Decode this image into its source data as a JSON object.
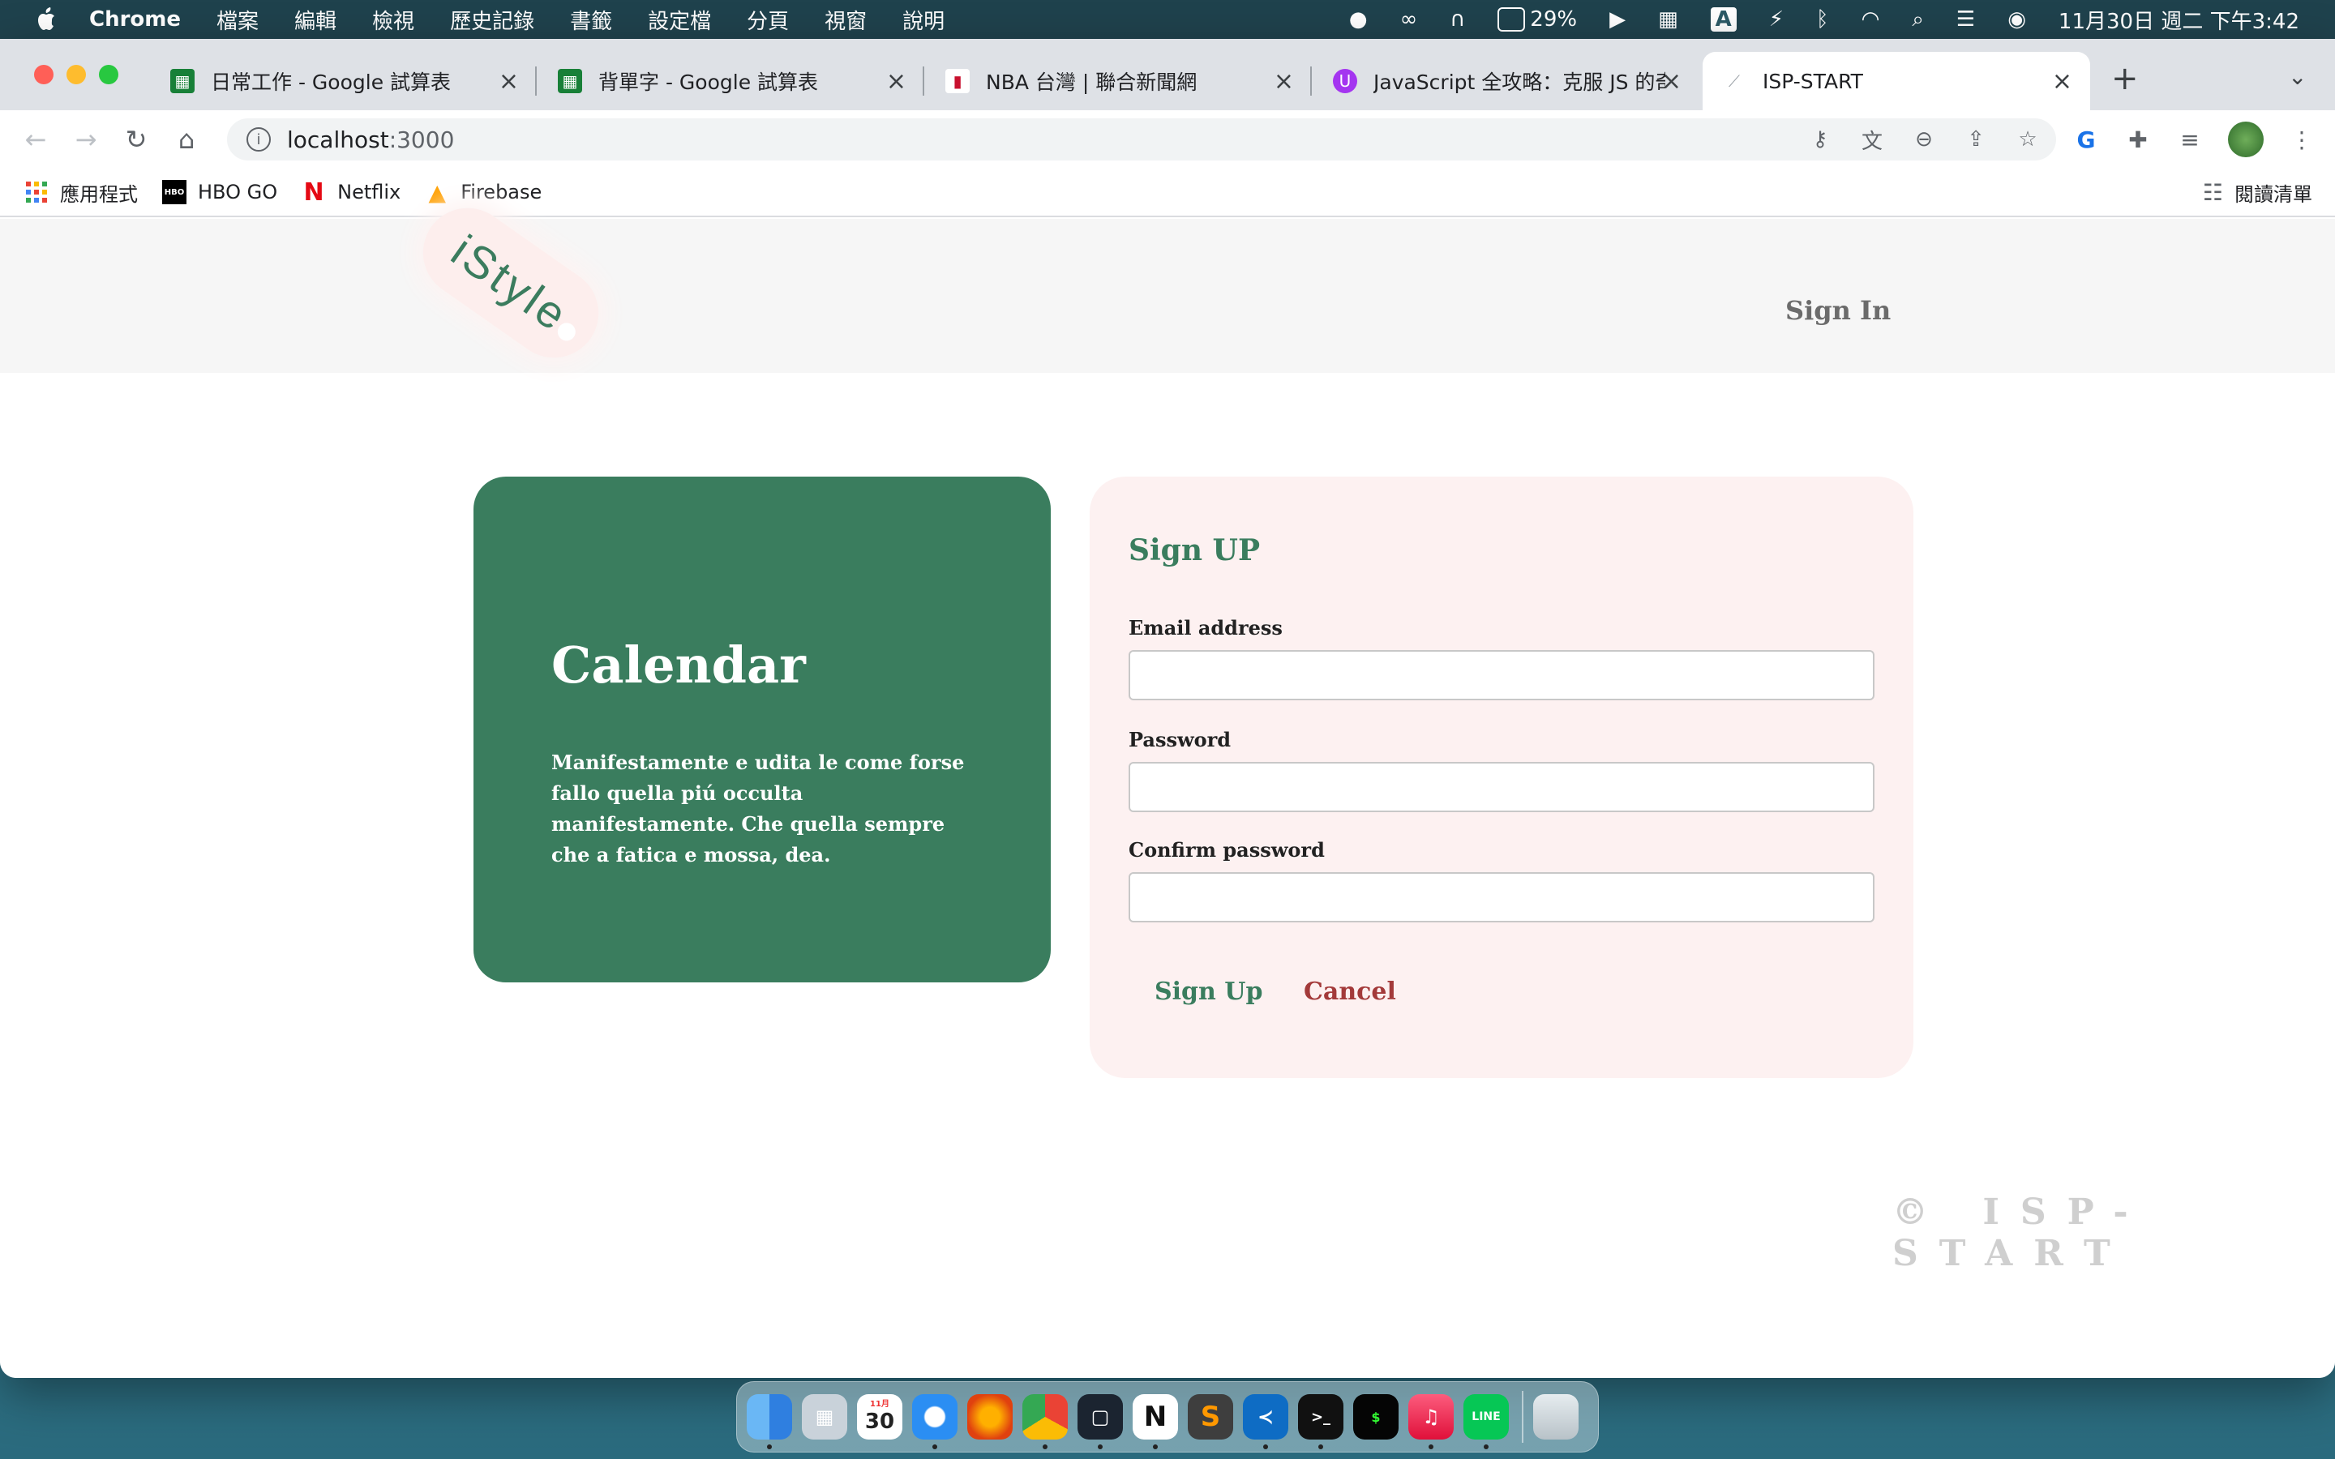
{
  "menubar": {
    "app": "Chrome",
    "menus": [
      "檔案",
      "編輯",
      "檢視",
      "歷史記錄",
      "書籤",
      "設定檔",
      "分頁",
      "視窗",
      "說明"
    ],
    "battery": "29%",
    "input_method": "A",
    "clock": "11月30日 週二 下午3:42"
  },
  "tabs": [
    {
      "title": "日常工作 - Google 試算表",
      "icon": "google-sheets-icon"
    },
    {
      "title": "背單字 - Google 試算表",
      "icon": "google-sheets-icon"
    },
    {
      "title": "NBA 台灣 | 聯合新聞網",
      "icon": "nba-icon"
    },
    {
      "title": "JavaScript 全攻略：克服 JS 的奇",
      "icon": "udemy-icon"
    },
    {
      "title": "ISP-START",
      "icon": "page-icon"
    }
  ],
  "address": {
    "host": "localhost",
    "port": ":3000"
  },
  "bookmarks": [
    {
      "label": "應用程式",
      "icon": "apps-grid-icon"
    },
    {
      "label": "HBO GO",
      "icon": "hbo-icon"
    },
    {
      "label": "Netflix",
      "icon": "netflix-icon"
    },
    {
      "label": "Firebase",
      "icon": "firebase-icon"
    }
  ],
  "reading_list": "閱讀清單",
  "site": {
    "logo": "iStyle",
    "nav_signin": "Sign In",
    "hero": {
      "title": "Calendar",
      "body": "Manifestamente e udita le come forse fallo quella piú occulta manifestamente. Che quella sempre che a fatica e mossa, dea."
    },
    "form": {
      "title": "Sign UP",
      "email_label": "Email address",
      "password_label": "Password",
      "confirm_label": "Confirm password",
      "email_value": "",
      "password_value": "",
      "confirm_value": "",
      "submit_label": "Sign Up",
      "cancel_label": "Cancel"
    },
    "footer": "© ISP-START"
  },
  "dock": {
    "calendar_day": "30",
    "calendar_month": "11月"
  },
  "colors": {
    "brand_green": "#3a7d5e",
    "form_bg": "#fdf1f1",
    "cancel_red": "#a33a3a"
  }
}
